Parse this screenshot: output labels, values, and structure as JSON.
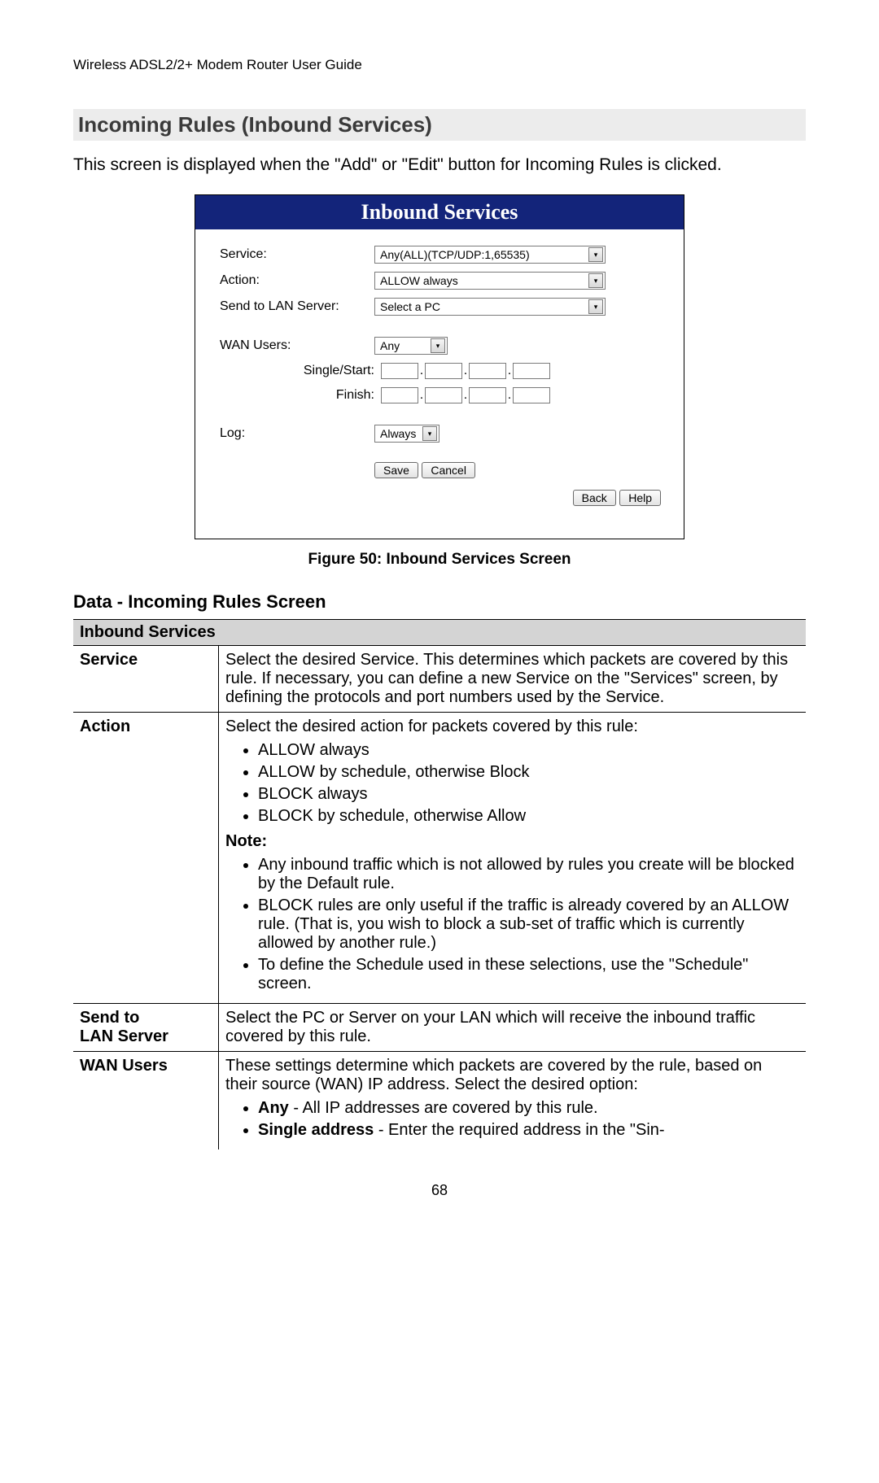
{
  "running_head": "Wireless ADSL2/2+ Modem Router User Guide",
  "section_heading": "Incoming Rules (Inbound Services)",
  "intro_text": "This screen is displayed when the \"Add\" or \"Edit\" button for Incoming Rules is clicked.",
  "panel": {
    "title": "Inbound Services",
    "labels": {
      "service": "Service:",
      "action": "Action:",
      "send_to_lan": "Send to LAN Server:",
      "wan_users": "WAN Users:",
      "single_start": "Single/Start:",
      "finish": "Finish:",
      "log": "Log:"
    },
    "values": {
      "service": "Any(ALL)(TCP/UDP:1,65535)",
      "action": "ALLOW always",
      "send_to_lan": "Select a PC",
      "wan_users": "Any",
      "log": "Always"
    },
    "buttons": {
      "save": "Save",
      "cancel": "Cancel",
      "back": "Back",
      "help": "Help"
    }
  },
  "figure_caption": "Figure 50: Inbound Services Screen",
  "subheading": "Data - Incoming Rules Screen",
  "table": {
    "title": "Inbound Services",
    "rows": {
      "service": {
        "key": "Service",
        "desc": "Select the desired Service. This determines which packets are covered by this rule. If necessary, you can define a new Service on the \"Services\" screen, by defining the protocols and port numbers used by the Service."
      },
      "action": {
        "key": "Action",
        "lead": "Select the desired action for packets covered by this rule:",
        "options": [
          "ALLOW always",
          "ALLOW by schedule, otherwise Block",
          "BLOCK always",
          "BLOCK by schedule, otherwise Allow"
        ],
        "note_label": "Note:",
        "notes": [
          "Any inbound traffic which is not allowed by rules you create will be blocked by the Default rule.",
          "BLOCK rules are only useful if the traffic is already covered by an ALLOW rule. (That is, you wish to block a sub-set of traffic which is currently allowed by another rule.)",
          "To define the Schedule used in these selections, use the \"Schedule\" screen."
        ]
      },
      "send_to_lan": {
        "key": "Send to\nLAN Server",
        "desc": "Select the PC or Server on your LAN which will receive the inbound traffic covered by this rule."
      },
      "wan_users": {
        "key": "WAN Users",
        "lead": "These settings determine which packets are covered by the rule, based on their source (WAN) IP address. Select the desired option:",
        "items": [
          {
            "bold": "Any",
            "rest": " - All IP addresses are covered by this rule."
          },
          {
            "bold": "Single address",
            "rest": " - Enter the required address in the \"Sin-"
          }
        ]
      }
    }
  },
  "page_number": "68"
}
